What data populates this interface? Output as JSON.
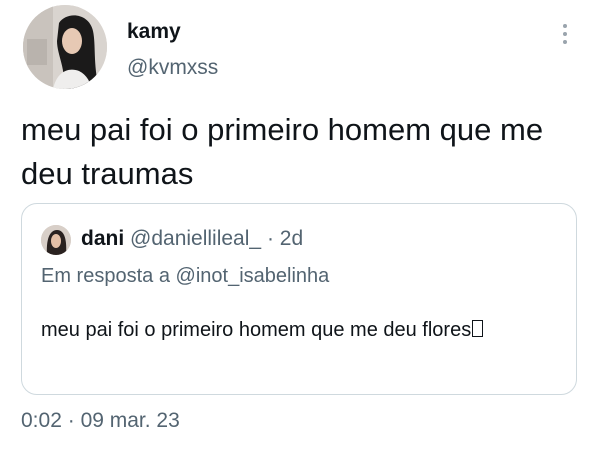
{
  "tweet": {
    "author_name": "kamy",
    "author_handle": "@kvmxss",
    "text": "meu pai foi o primeiro homem que me deu traumas",
    "time": "0:02",
    "separator": "·",
    "date": "09 mar. 23"
  },
  "quoted_tweet": {
    "author_name": "dani",
    "author_handle": "@daniellileal_",
    "separator": "·",
    "age": "2d",
    "reply_prefix": "Em resposta a",
    "reply_to": "@inot_isabelinha",
    "text": "meu pai foi o primeiro homem que me deu flores"
  },
  "icons": {
    "more_options": "more-vertical-icon"
  }
}
